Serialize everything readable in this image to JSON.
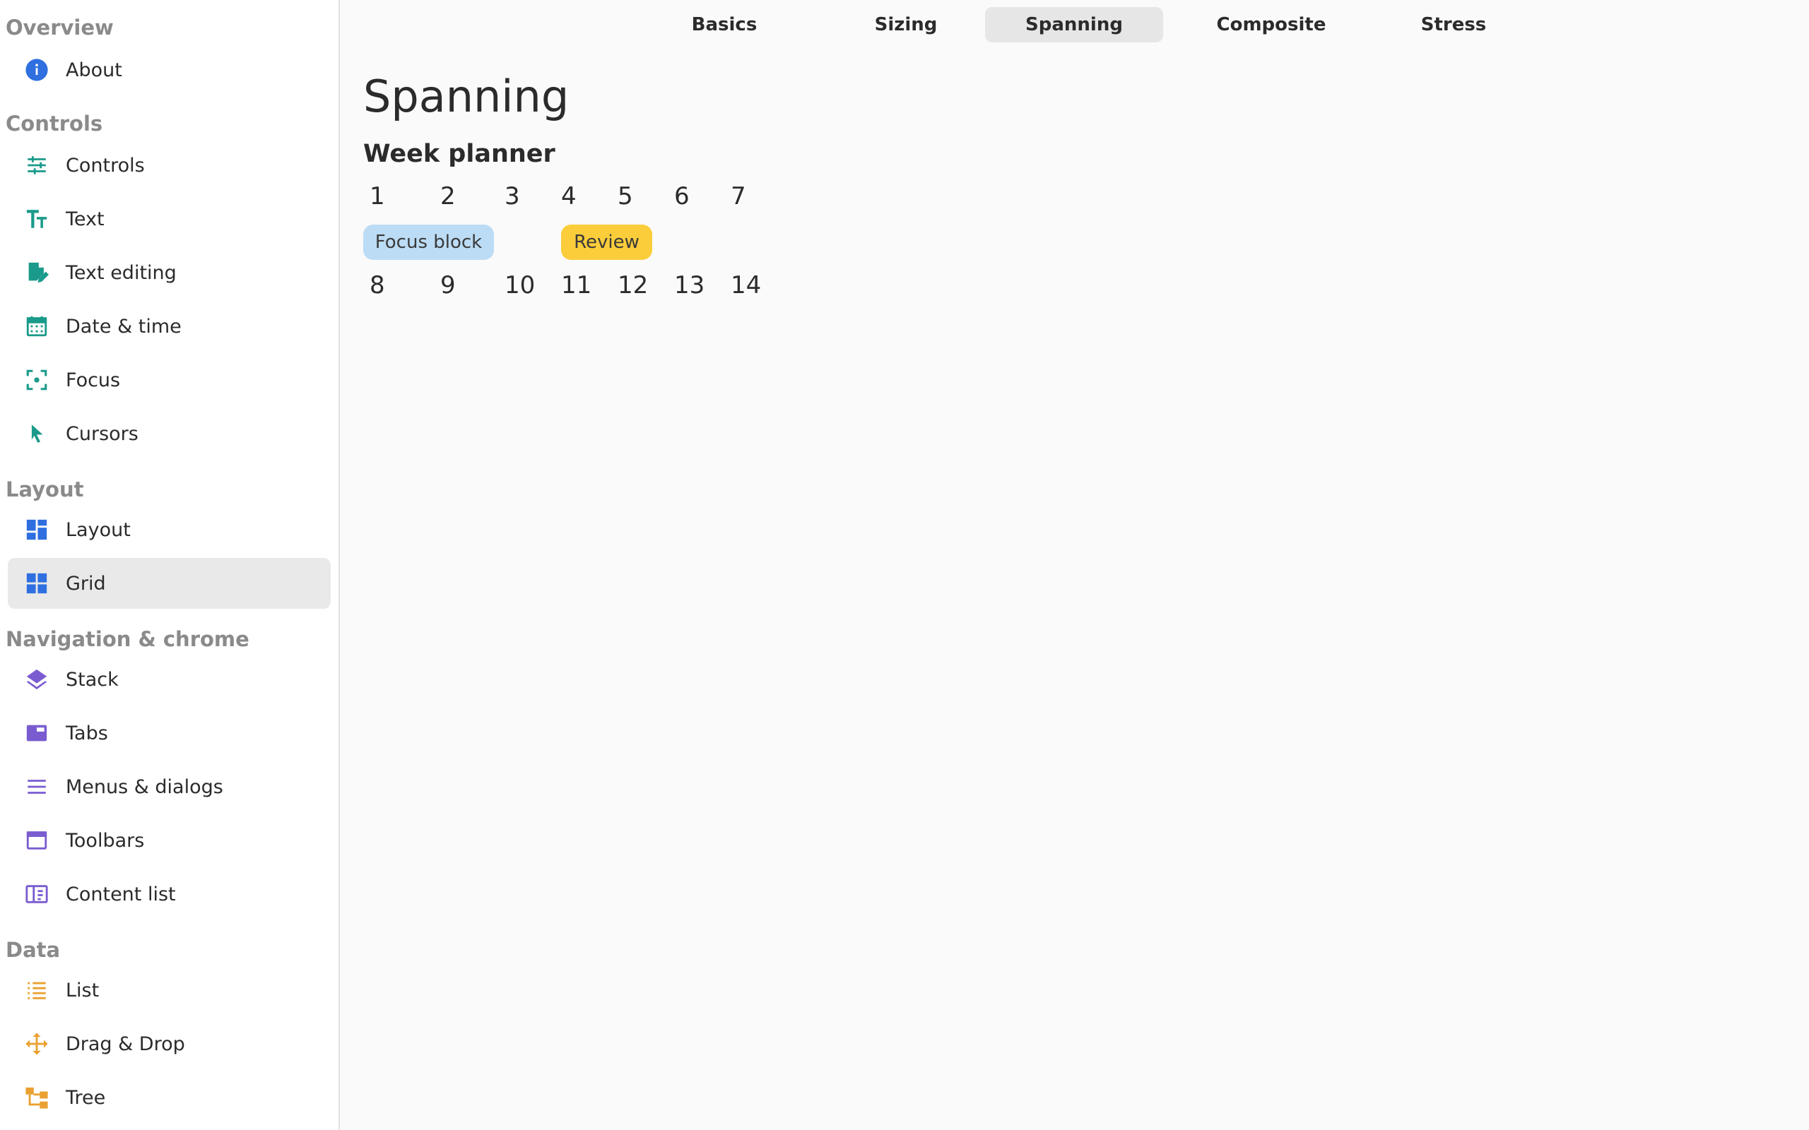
{
  "sidebar": {
    "sections": [
      {
        "title": "Overview",
        "items": [
          {
            "label": "About",
            "icon": "info-icon"
          }
        ]
      },
      {
        "title": "Controls",
        "items": [
          {
            "label": "Controls",
            "icon": "sliders-icon"
          },
          {
            "label": "Text",
            "icon": "text-format-icon"
          },
          {
            "label": "Text editing",
            "icon": "edit-document-icon"
          },
          {
            "label": "Date & time",
            "icon": "calendar-icon"
          },
          {
            "label": "Focus",
            "icon": "focus-icon"
          },
          {
            "label": "Cursors",
            "icon": "cursor-icon"
          }
        ]
      },
      {
        "title": "Layout",
        "items": [
          {
            "label": "Layout",
            "icon": "dashboard-icon"
          },
          {
            "label": "Grid",
            "icon": "grid-icon"
          }
        ]
      },
      {
        "title": "Navigation & chrome",
        "items": [
          {
            "label": "Stack",
            "icon": "layers-icon"
          },
          {
            "label": "Tabs",
            "icon": "tab-icon"
          },
          {
            "label": "Menus & dialogs",
            "icon": "menu-icon"
          },
          {
            "label": "Toolbars",
            "icon": "window-icon"
          },
          {
            "label": "Content list",
            "icon": "book-icon"
          }
        ]
      },
      {
        "title": "Data",
        "items": [
          {
            "label": "List",
            "icon": "list-icon"
          },
          {
            "label": "Drag & Drop",
            "icon": "move-icon"
          },
          {
            "label": "Tree",
            "icon": "tree-icon"
          }
        ]
      }
    ],
    "active_item": "Grid"
  },
  "tabs": {
    "items": [
      "Basics",
      "Sizing",
      "Spanning",
      "Composite",
      "Stress"
    ],
    "active": "Spanning"
  },
  "page": {
    "title": "Spanning",
    "section_title": "Week planner",
    "week1": [
      "1",
      "2",
      "3",
      "4",
      "5",
      "6",
      "7"
    ],
    "week2": [
      "8",
      "9",
      "10",
      "11",
      "12",
      "13",
      "14"
    ],
    "events": [
      {
        "label": "Focus block",
        "color": "#bcdcf5"
      },
      {
        "label": "Review",
        "color": "#fbcd3a"
      }
    ]
  },
  "colors": {
    "teal": "#1a9a8a",
    "blue": "#2f6fe0",
    "purple": "#7a5cd0",
    "orange": "#eaa131",
    "section_heading": "#8a8a8a",
    "active_background": "#e9e9e9"
  }
}
